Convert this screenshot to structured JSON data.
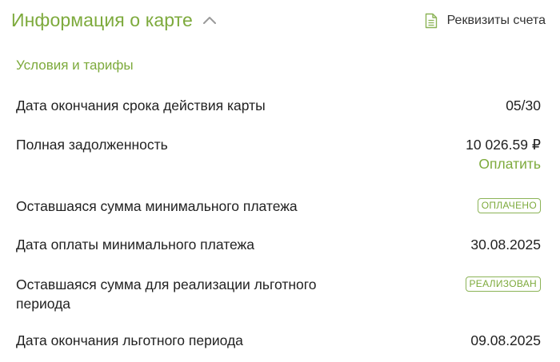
{
  "header": {
    "title": "Информация о карте",
    "details_label": "Реквизиты счета"
  },
  "section": {
    "title": "Условия и тарифы"
  },
  "rows": [
    {
      "label": "Дата окончания срока действия карты",
      "value": "05/30"
    },
    {
      "label": "Полная задолженность",
      "value": "10 026.59 ₽",
      "action": "Оплатить"
    },
    {
      "label": "Оставшаяся сумма минимального платежа",
      "badge": "ОПЛАЧЕНО"
    },
    {
      "label": "Дата оплаты минимального платежа",
      "value": "30.08.2025"
    },
    {
      "label": "Оставшаяся сумма для реализации льготного периода",
      "badge": "РЕАЛИЗОВАН"
    },
    {
      "label": "Дата окончания льготного периода",
      "value": "09.08.2025"
    }
  ],
  "icons": {
    "collapse": "chevron-up-icon",
    "details": "document-icon"
  },
  "colors": {
    "accent": "#7daa3c",
    "text": "#222222",
    "badge_border": "#8bb356"
  }
}
